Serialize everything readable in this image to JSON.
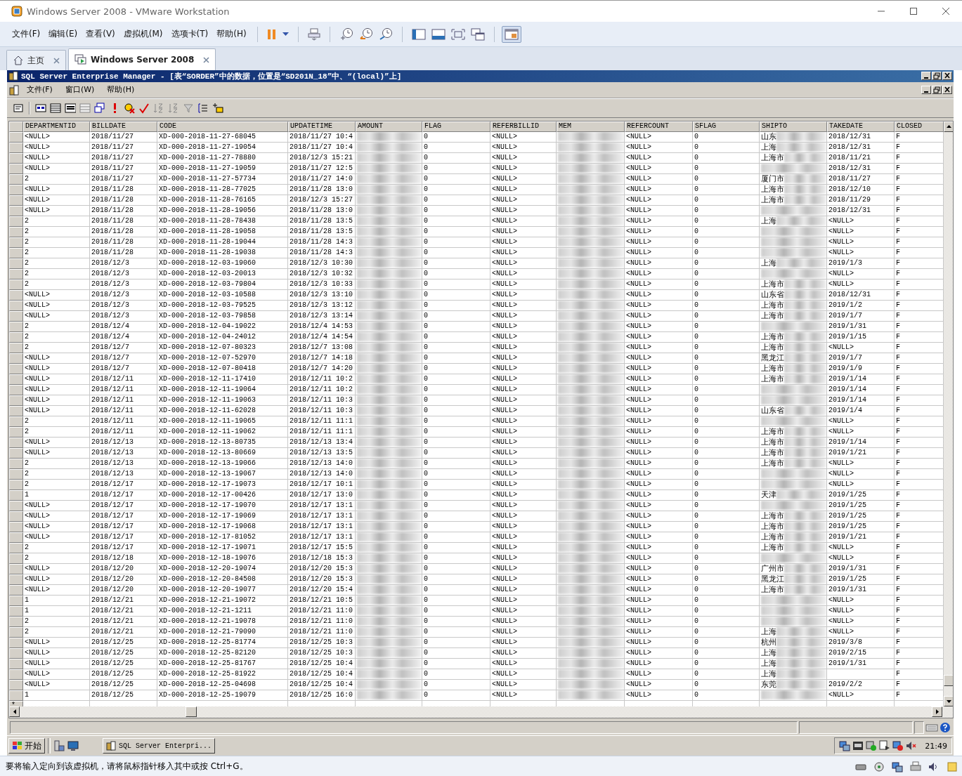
{
  "window": {
    "title": "Windows Server 2008 - VMware Workstation"
  },
  "menu": [
    "文件(F)",
    "编辑(E)",
    "查看(V)",
    "虚拟机(M)",
    "选项卡(T)",
    "帮助(H)"
  ],
  "tabs": [
    {
      "label": "主页",
      "selected": false
    },
    {
      "label": "Windows Server 2008",
      "selected": true
    }
  ],
  "guest": {
    "app_title": "SQL Server Enterprise Manager - [表“SORDER”中的数据，位置是“SD201N_18”中、“(local)”上]",
    "menu": [
      "文件(F)",
      "窗口(W)",
      "帮助(H)"
    ],
    "grid": {
      "columns": [
        {
          "label": "DEPARTMENTID",
          "kind": "text"
        },
        {
          "label": "BILLDATE",
          "kind": "text"
        },
        {
          "label": "CODE",
          "kind": "text"
        },
        {
          "label": "UPDATETIME",
          "kind": "text"
        },
        {
          "label": "AMOUNT",
          "kind": "blurred"
        },
        {
          "label": "FLAG",
          "kind": "text"
        },
        {
          "label": "REFERBILLID",
          "kind": "text"
        },
        {
          "label": "MEM",
          "kind": "blurred"
        },
        {
          "label": "REFERCOUNT",
          "kind": "text"
        },
        {
          "label": "SFLAG",
          "kind": "text"
        },
        {
          "label": "SHIPTO",
          "kind": "partly_blurred"
        },
        {
          "label": "TAKEDATE",
          "kind": "text"
        },
        {
          "label": "CLOSED",
          "kind": "text"
        }
      ],
      "rows": [
        [
          "<NULL>",
          "2018/11/27",
          "XD-000-2018-11-27-68045",
          "2018/11/27 10:4",
          null,
          "0",
          "<NULL>",
          null,
          "<NULL>",
          "0",
          "山东",
          "2018/12/31",
          "F"
        ],
        [
          "<NULL>",
          "2018/11/27",
          "XD-000-2018-11-27-19054",
          "2018/11/27 10:4",
          null,
          "0",
          "<NULL>",
          null,
          "<NULL>",
          "0",
          "上海",
          "2018/12/31",
          "F"
        ],
        [
          "<NULL>",
          "2018/11/27",
          "XD-000-2018-11-27-78880",
          "2018/12/3 15:21",
          null,
          "0",
          "<NULL>",
          null,
          "<NULL>",
          "0",
          "上海市",
          "2018/11/21",
          "F"
        ],
        [
          "<NULL>",
          "2018/11/27",
          "XD-000-2018-11-27-19059",
          "2018/11/27 12:5",
          null,
          "0",
          "<NULL>",
          null,
          "<NULL>",
          "0",
          null,
          "2018/12/31",
          "F"
        ],
        [
          "2",
          "2018/11/27",
          "XD-000-2018-11-27-57734",
          "2018/11/27 14:0",
          null,
          "0",
          "<NULL>",
          null,
          "<NULL>",
          "0",
          "厦门市",
          "2018/11/27",
          "F"
        ],
        [
          "<NULL>",
          "2018/11/28",
          "XD-000-2018-11-28-77025",
          "2018/11/28 13:0",
          null,
          "0",
          "<NULL>",
          null,
          "<NULL>",
          "0",
          "上海市",
          "2018/12/10",
          "F"
        ],
        [
          "<NULL>",
          "2018/11/28",
          "XD-000-2018-11-28-76165",
          "2018/12/3 15:27",
          null,
          "0",
          "<NULL>",
          null,
          "<NULL>",
          "0",
          "上海市",
          "2018/11/29",
          "F"
        ],
        [
          "<NULL>",
          "2018/11/28",
          "XD-000-2018-11-28-19056",
          "2018/11/28 13:0",
          null,
          "0",
          "<NULL>",
          null,
          "<NULL>",
          "0",
          null,
          "2018/12/31",
          "F"
        ],
        [
          "2",
          "2018/11/28",
          "XD-000-2018-11-28-78438",
          "2018/11/28 13:5",
          null,
          "0",
          "<NULL>",
          null,
          "<NULL>",
          "0",
          "上海",
          "<NULL>",
          "F"
        ],
        [
          "2",
          "2018/11/28",
          "XD-000-2018-11-28-19058",
          "2018/11/28 13:5",
          null,
          "0",
          "<NULL>",
          null,
          "<NULL>",
          "0",
          null,
          "<NULL>",
          "F"
        ],
        [
          "2",
          "2018/11/28",
          "XD-000-2018-11-28-19044",
          "2018/11/28 14:3",
          null,
          "0",
          "<NULL>",
          null,
          "<NULL>",
          "0",
          null,
          "<NULL>",
          "F"
        ],
        [
          "2",
          "2018/11/28",
          "XD-000-2018-11-28-19038",
          "2018/11/28 14:3",
          null,
          "0",
          "<NULL>",
          null,
          "<NULL>",
          "0",
          null,
          "<NULL>",
          "F"
        ],
        [
          "2",
          "2018/12/3",
          "XD-000-2018-12-03-19060",
          "2018/12/3 10:30",
          null,
          "0",
          "<NULL>",
          null,
          "<NULL>",
          "0",
          "上海",
          "2019/1/3",
          "F"
        ],
        [
          "2",
          "2018/12/3",
          "XD-000-2018-12-03-20013",
          "2018/12/3 10:32",
          null,
          "0",
          "<NULL>",
          null,
          "<NULL>",
          "0",
          null,
          "<NULL>",
          "F"
        ],
        [
          "2",
          "2018/12/3",
          "XD-000-2018-12-03-79804",
          "2018/12/3 10:33",
          null,
          "0",
          "<NULL>",
          null,
          "<NULL>",
          "0",
          "上海市",
          "<NULL>",
          "F"
        ],
        [
          "<NULL>",
          "2018/12/3",
          "XD-000-2018-12-03-10588",
          "2018/12/3 13:10",
          null,
          "0",
          "<NULL>",
          null,
          "<NULL>",
          "0",
          "山东省",
          "2018/12/31",
          "F"
        ],
        [
          "<NULL>",
          "2018/12/3",
          "XD-000-2018-12-03-79525",
          "2018/12/3 13:12",
          null,
          "0",
          "<NULL>",
          null,
          "<NULL>",
          "0",
          "上海市",
          "2019/1/2",
          "F"
        ],
        [
          "<NULL>",
          "2018/12/3",
          "XD-000-2018-12-03-79858",
          "2018/12/3 13:14",
          null,
          "0",
          "<NULL>",
          null,
          "<NULL>",
          "0",
          "上海市",
          "2019/1/7",
          "F"
        ],
        [
          "2",
          "2018/12/4",
          "XD-000-2018-12-04-19022",
          "2018/12/4 14:53",
          null,
          "0",
          "<NULL>",
          null,
          "<NULL>",
          "0",
          null,
          "2019/1/31",
          "F"
        ],
        [
          "2",
          "2018/12/4",
          "XD-000-2018-12-04-24012",
          "2018/12/4 14:54",
          null,
          "0",
          "<NULL>",
          null,
          "<NULL>",
          "0",
          "上海市",
          "2019/1/15",
          "F"
        ],
        [
          "2",
          "2018/12/7",
          "XD-000-2018-12-07-80323",
          "2018/12/7 13:08",
          null,
          "0",
          "<NULL>",
          null,
          "<NULL>",
          "0",
          "上海市",
          "<NULL>",
          "F"
        ],
        [
          "<NULL>",
          "2018/12/7",
          "XD-000-2018-12-07-52970",
          "2018/12/7 14:18",
          null,
          "0",
          "<NULL>",
          null,
          "<NULL>",
          "0",
          "黑龙江",
          "2019/1/7",
          "F"
        ],
        [
          "<NULL>",
          "2018/12/7",
          "XD-000-2018-12-07-80418",
          "2018/12/7 14:20",
          null,
          "0",
          "<NULL>",
          null,
          "<NULL>",
          "0",
          "上海市",
          "2019/1/9",
          "F"
        ],
        [
          "<NULL>",
          "2018/12/11",
          "XD-000-2018-12-11-17410",
          "2018/12/11 10:2",
          null,
          "0",
          "<NULL>",
          null,
          "<NULL>",
          "0",
          "上海市",
          "2019/1/14",
          "F"
        ],
        [
          "<NULL>",
          "2018/12/11",
          "XD-000-2018-12-11-19064",
          "2018/12/11 10:2",
          null,
          "0",
          "<NULL>",
          null,
          "<NULL>",
          "0",
          null,
          "2019/1/14",
          "F"
        ],
        [
          "<NULL>",
          "2018/12/11",
          "XD-000-2018-12-11-19063",
          "2018/12/11 10:3",
          null,
          "0",
          "<NULL>",
          null,
          "<NULL>",
          "0",
          null,
          "2019/1/14",
          "F"
        ],
        [
          "<NULL>",
          "2018/12/11",
          "XD-000-2018-12-11-62028",
          "2018/12/11 10:3",
          null,
          "0",
          "<NULL>",
          null,
          "<NULL>",
          "0",
          "山东省",
          "2019/1/4",
          "F"
        ],
        [
          "2",
          "2018/12/11",
          "XD-000-2018-12-11-19065",
          "2018/12/11 11:1",
          null,
          "0",
          "<NULL>",
          null,
          "<NULL>",
          "0",
          null,
          "<NULL>",
          "F"
        ],
        [
          "2",
          "2018/12/11",
          "XD-000-2018-12-11-19062",
          "2018/12/11 11:1",
          null,
          "0",
          "<NULL>",
          null,
          "<NULL>",
          "0",
          "上海市",
          "<NULL>",
          "F"
        ],
        [
          "<NULL>",
          "2018/12/13",
          "XD-000-2018-12-13-80735",
          "2018/12/13 13:4",
          null,
          "0",
          "<NULL>",
          null,
          "<NULL>",
          "0",
          "上海市",
          "2019/1/14",
          "F"
        ],
        [
          "<NULL>",
          "2018/12/13",
          "XD-000-2018-12-13-80669",
          "2018/12/13 13:5",
          null,
          "0",
          "<NULL>",
          null,
          "<NULL>",
          "0",
          "上海市",
          "2019/1/21",
          "F"
        ],
        [
          "2",
          "2018/12/13",
          "XD-000-2018-12-13-19066",
          "2018/12/13 14:0",
          null,
          "0",
          "<NULL>",
          null,
          "<NULL>",
          "0",
          "上海市",
          "<NULL>",
          "F"
        ],
        [
          "2",
          "2018/12/13",
          "XD-000-2018-12-13-19067",
          "2018/12/13 14:0",
          null,
          "0",
          "<NULL>",
          null,
          "<NULL>",
          "0",
          null,
          "<NULL>",
          "F"
        ],
        [
          "2",
          "2018/12/17",
          "XD-000-2018-12-17-19073",
          "2018/12/17 10:1",
          null,
          "0",
          "<NULL>",
          null,
          "<NULL>",
          "0",
          null,
          "<NULL>",
          "F"
        ],
        [
          "1",
          "2018/12/17",
          "XD-000-2018-12-17-00426",
          "2018/12/17 13:0",
          null,
          "0",
          "<NULL>",
          null,
          "<NULL>",
          "0",
          "天津",
          "2019/1/25",
          "F"
        ],
        [
          "<NULL>",
          "2018/12/17",
          "XD-000-2018-12-17-19070",
          "2018/12/17 13:1",
          null,
          "0",
          "<NULL>",
          null,
          "<NULL>",
          "0",
          null,
          "2019/1/25",
          "F"
        ],
        [
          "<NULL>",
          "2018/12/17",
          "XD-000-2018-12-17-19069",
          "2018/12/17 13:1",
          null,
          "0",
          "<NULL>",
          null,
          "<NULL>",
          "0",
          "上海市",
          "2019/1/25",
          "F"
        ],
        [
          "<NULL>",
          "2018/12/17",
          "XD-000-2018-12-17-19068",
          "2018/12/17 13:1",
          null,
          "0",
          "<NULL>",
          null,
          "<NULL>",
          "0",
          "上海市",
          "2019/1/25",
          "F"
        ],
        [
          "<NULL>",
          "2018/12/17",
          "XD-000-2018-12-17-81052",
          "2018/12/17 13:1",
          null,
          "0",
          "<NULL>",
          null,
          "<NULL>",
          "0",
          "上海市",
          "2019/1/21",
          "F"
        ],
        [
          "2",
          "2018/12/17",
          "XD-000-2018-12-17-19071",
          "2018/12/17 15:5",
          null,
          "0",
          "<NULL>",
          null,
          "<NULL>",
          "0",
          "上海市",
          "<NULL>",
          "F"
        ],
        [
          "2",
          "2018/12/18",
          "XD-000-2018-12-18-19076",
          "2018/12/18 15:3",
          null,
          "0",
          "<NULL>",
          null,
          "<NULL>",
          "0",
          null,
          "<NULL>",
          "F"
        ],
        [
          "<NULL>",
          "2018/12/20",
          "XD-000-2018-12-20-19074",
          "2018/12/20 15:3",
          null,
          "0",
          "<NULL>",
          null,
          "<NULL>",
          "0",
          "广州市",
          "2019/1/31",
          "F"
        ],
        [
          "<NULL>",
          "2018/12/20",
          "XD-000-2018-12-20-84508",
          "2018/12/20 15:3",
          null,
          "0",
          "<NULL>",
          null,
          "<NULL>",
          "0",
          "黑龙江",
          "2019/1/25",
          "F"
        ],
        [
          "<NULL>",
          "2018/12/20",
          "XD-000-2018-12-20-19077",
          "2018/12/20 15:4",
          null,
          "0",
          "<NULL>",
          null,
          "<NULL>",
          "0",
          "上海市",
          "2019/1/31",
          "F"
        ],
        [
          "1",
          "2018/12/21",
          "XD-000-2018-12-21-19072",
          "2018/12/21 10:5",
          null,
          "0",
          "<NULL>",
          null,
          "<NULL>",
          "0",
          null,
          "<NULL>",
          "F"
        ],
        [
          "1",
          "2018/12/21",
          "XD-000-2018-12-21-1211",
          "2018/12/21 11:0",
          null,
          "0",
          "<NULL>",
          null,
          "<NULL>",
          "0",
          null,
          "<NULL>",
          "F"
        ],
        [
          "2",
          "2018/12/21",
          "XD-000-2018-12-21-19078",
          "2018/12/21 11:0",
          null,
          "0",
          "<NULL>",
          null,
          "<NULL>",
          "0",
          null,
          "<NULL>",
          "F"
        ],
        [
          "2",
          "2018/12/21",
          "XD-000-2018-12-21-79090",
          "2018/12/21 11:0",
          null,
          "0",
          "<NULL>",
          null,
          "<NULL>",
          "0",
          "上海",
          "<NULL>",
          "F"
        ],
        [
          "<NULL>",
          "2018/12/25",
          "XD-000-2018-12-25-81774",
          "2018/12/25 10:3",
          null,
          "0",
          "<NULL>",
          null,
          "<NULL>",
          "0",
          "杭州",
          "2019/3/8",
          "F"
        ],
        [
          "<NULL>",
          "2018/12/25",
          "XD-000-2018-12-25-82120",
          "2018/12/25 10:3",
          null,
          "0",
          "<NULL>",
          null,
          "<NULL>",
          "0",
          "上海",
          "2019/2/15",
          "F"
        ],
        [
          "<NULL>",
          "2018/12/25",
          "XD-000-2018-12-25-81767",
          "2018/12/25 10:4",
          null,
          "0",
          "<NULL>",
          null,
          "<NULL>",
          "0",
          "上海",
          "2019/1/31",
          "F"
        ],
        [
          "<NULL>",
          "2018/12/25",
          "XD-000-2018-12-25-81922",
          "2018/12/25 10:4",
          null,
          "0",
          "<NULL>",
          null,
          "<NULL>",
          "0",
          "上海",
          null,
          "F"
        ],
        [
          "<NULL>",
          "2018/12/25",
          "XD-000-2018-12-25-04698",
          "2018/12/25 10:4",
          null,
          "0",
          "<NULL>",
          null,
          "<NULL>",
          "0",
          "东莞",
          "2019/2/2",
          "F"
        ],
        [
          "1",
          "2018/12/25",
          "XD-000-2018-12-25-19079",
          "2018/12/25 16:0",
          null,
          "0",
          "<NULL>",
          null,
          "<NULL>",
          "0",
          null,
          "<NULL>",
          "F"
        ]
      ],
      "new_row_marker": "*"
    },
    "taskbar": {
      "start": "开始",
      "tasks": [
        {
          "label": "SQL Server Enterpri...",
          "selected": false
        }
      ],
      "clock": "21:49"
    }
  },
  "status_bar": {
    "message": "要将输入定向到该虚拟机，请将鼠标指针移入其中或按 Ctrl+G。"
  }
}
